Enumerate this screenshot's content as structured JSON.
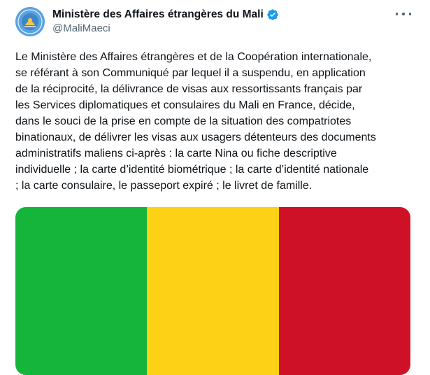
{
  "author": {
    "display_name": "Ministère des Affaires étrangères du Mali",
    "handle": "@MaliMaeci",
    "avatar_icon": "ministry-seal-avatar",
    "verified_icon": "verified-badge-icon",
    "verified_color": "#1d9bf0"
  },
  "menu": {
    "icon": "more-options-icon"
  },
  "tweet": {
    "text_lines": [
      "Le Ministère des Affaires étrangères et de la Coopération internationale,",
      "se référant à son Communiqué par lequel il a suspendu, en application",
      "de la réciprocité, la délivrance de visas aux ressortissants français par",
      "les Services diplomatiques et consulaires du Mali en France, décide,",
      "dans le souci de la prise en compte de la situation des compatriotes",
      "binationaux, de délivrer les visas aux usagers détenteurs des documents",
      "administratifs maliens ci-après : la  carte Nina ou fiche descriptive",
      "individuelle ; la carte d’identité biométrique ; la carte d’identité nationale",
      "; la carte consulaire, le passeport expiré ; le livret de famille."
    ]
  },
  "media": {
    "description_icon": "mali-flag-image",
    "stripe_colors": [
      "#14b53a",
      "#fcd116",
      "#ce1126"
    ]
  },
  "colors": {
    "text": "#0f1419",
    "secondary_text": "#536471",
    "background": "#ffffff"
  }
}
